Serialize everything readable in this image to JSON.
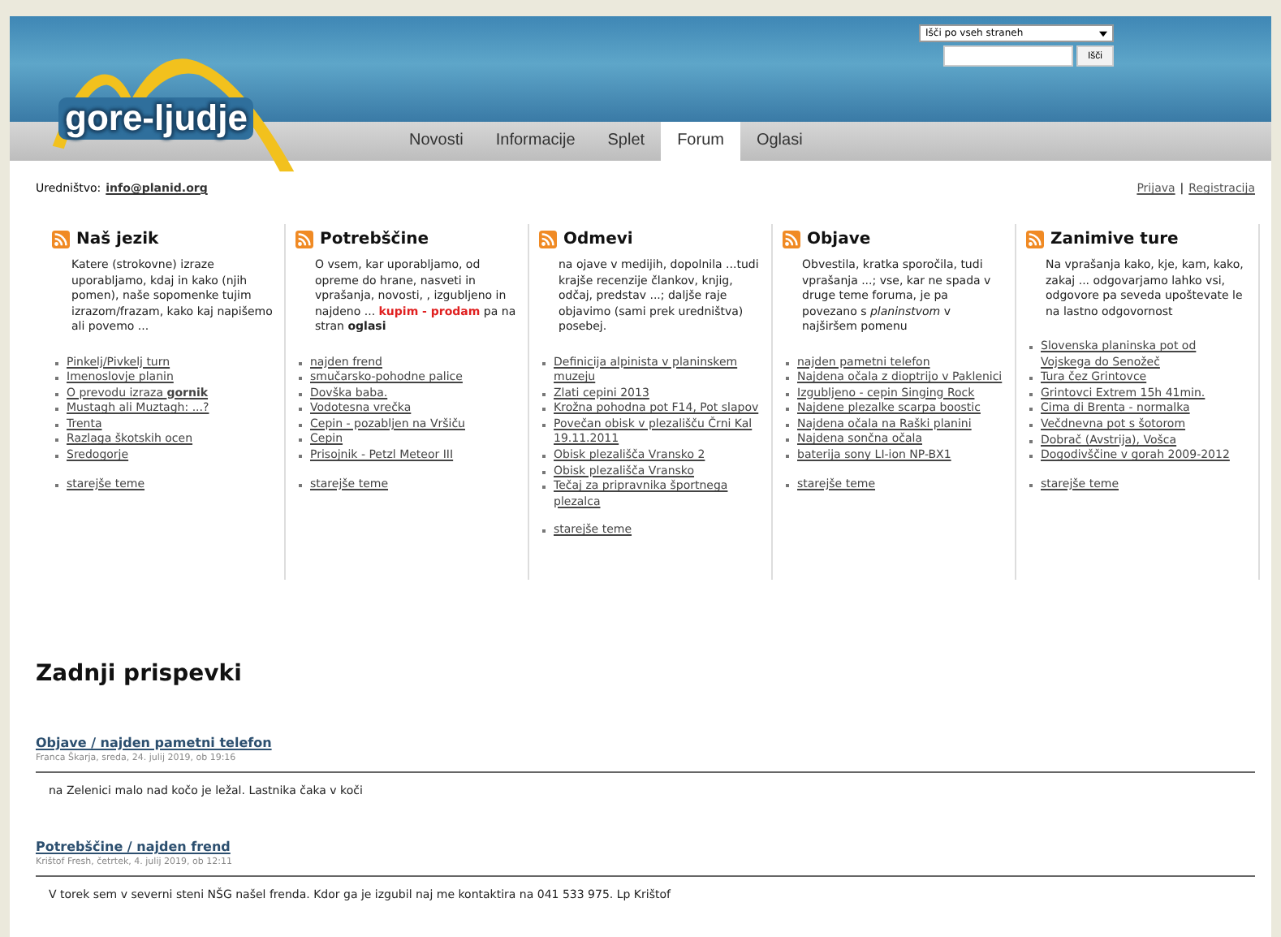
{
  "search": {
    "scope": "Išči po vseh straneh",
    "button": "Išči"
  },
  "logo": "gore-ljudje",
  "nav": [
    {
      "label": "Novosti",
      "selected": false
    },
    {
      "label": "Informacije",
      "selected": false
    },
    {
      "label": "Splet",
      "selected": false
    },
    {
      "label": "Forum",
      "selected": true
    },
    {
      "label": "Oglasi",
      "selected": false
    }
  ],
  "editor": {
    "label": "Uredništvo:",
    "email": "info@planid.org"
  },
  "account": {
    "login": "Prijava",
    "separator": "|",
    "register": "Registracija"
  },
  "columns": [
    {
      "title": "Naš jezik",
      "description": [
        {
          "kind": "plain",
          "text": "Katere (strokovne) izraze uporabljamo, kdaj in kako (njih pomen), naše sopomenke tujim izrazom/frazam, kako kaj napišemo ali povemo ..."
        }
      ],
      "links": [
        "Pinkelj/Pivkelj turn",
        "Imenoslovje planin",
        "O prevodu izraza **gornik**",
        "Mustagh ali Muztagh: ...?",
        "Trenta",
        "Razlaga škotskih ocen",
        "Sredogorje"
      ],
      "more": "starejše teme"
    },
    {
      "title": "Potrebščine",
      "description": [
        {
          "kind": "plain",
          "text": "O vsem, kar uporabljamo, od opreme do hrane, nasveti in vprašanja, novosti, , izgubljeno in najdeno ... "
        },
        {
          "kind": "alert",
          "text": "kupim - prodam"
        },
        {
          "kind": "plain",
          "text": " pa na stran "
        },
        {
          "kind": "bold",
          "text": "oglasi"
        }
      ],
      "links": [
        "najden frend",
        "smučarsko-pohodne palice",
        "Dovška baba.",
        "Vodotesna vrečka",
        "Cepin - pozabljen na Vršiču",
        "Cepin",
        "Prisojnik - Petzl Meteor III"
      ],
      "more": "starejše teme"
    },
    {
      "title": "Odmevi",
      "description": [
        {
          "kind": "plain",
          "text": "na ojave v medijih, dopolnila ...tudi krajše recenzije člankov, knjig, odčaj, predstav ...; daljše raje objavimo (sami prek uredništva) posebej."
        }
      ],
      "links": [
        "Definicija alpinista v planinskem muzeju",
        "Zlati cepini 2013",
        "Krožna pohodna pot F14, Pot slapov",
        "Povečan obisk v plezališču Črni Kal 19.11.2011",
        "Obisk plezališča Vransko 2",
        "Obisk plezališča Vransko",
        "Tečaj za pripravnika športnega plezalca"
      ],
      "more": "starejše teme"
    },
    {
      "title": "Objave",
      "description": [
        {
          "kind": "plain",
          "text": "Obvestila, kratka sporočila, tudi vprašanja ...; vse, kar ne spada v druge teme foruma, je pa povezano s "
        },
        {
          "kind": "italic",
          "text": "planinstvom"
        },
        {
          "kind": "plain",
          "text": " v najširšem pomenu"
        }
      ],
      "links": [
        "najden pametni telefon",
        "Najdena očala z dioptrijo v Paklenici",
        "Izgubljeno - cepin Singing Rock",
        "Najdene plezalke scarpa boostic",
        "Najdena očala na Raški planini",
        "Najdena sončna očala",
        "baterija sony LI-ion NP-BX1"
      ],
      "more": "starejše teme"
    },
    {
      "title": "Zanimive ture",
      "description": [
        {
          "kind": "plain",
          "text": "Na vprašanja kako, kje, kam, kako, zakaj ... odgovarjamo lahko vsi, odgovore pa seveda upoštevate le na lastno odgovornost"
        }
      ],
      "links": [
        "Slovenska planinska pot od Vojskega do Senožeč",
        "Tura čez Grintovce",
        "Grintovci Extrem 15h 41min.",
        "Cima di Brenta - normalka",
        "Večdnevna pot s šotorom",
        "Dobrač (Avstrija), Vošca",
        "Dogodivščine v gorah 2009-2012"
      ],
      "more": "starejše teme"
    }
  ],
  "recent": {
    "title": "Zadnji prispevki",
    "posts": [
      {
        "title": "Objave / najden pametni telefon",
        "meta": "Franca Škarja, sreda, 24. julij 2019, ob 19:16",
        "body": "na Zelenici malo nad kočo je ležal. Lastnika čaka v koči"
      },
      {
        "title": "Potrebščine / najden frend",
        "meta": "Krištof Fresh, četrtek, 4. julij 2019, ob 12:11",
        "body": "V torek sem v severni steni NŠG našel frenda. Kdor ga je izgubil naj me kontaktira na 041 533 975. Lp Krištof"
      }
    ]
  }
}
